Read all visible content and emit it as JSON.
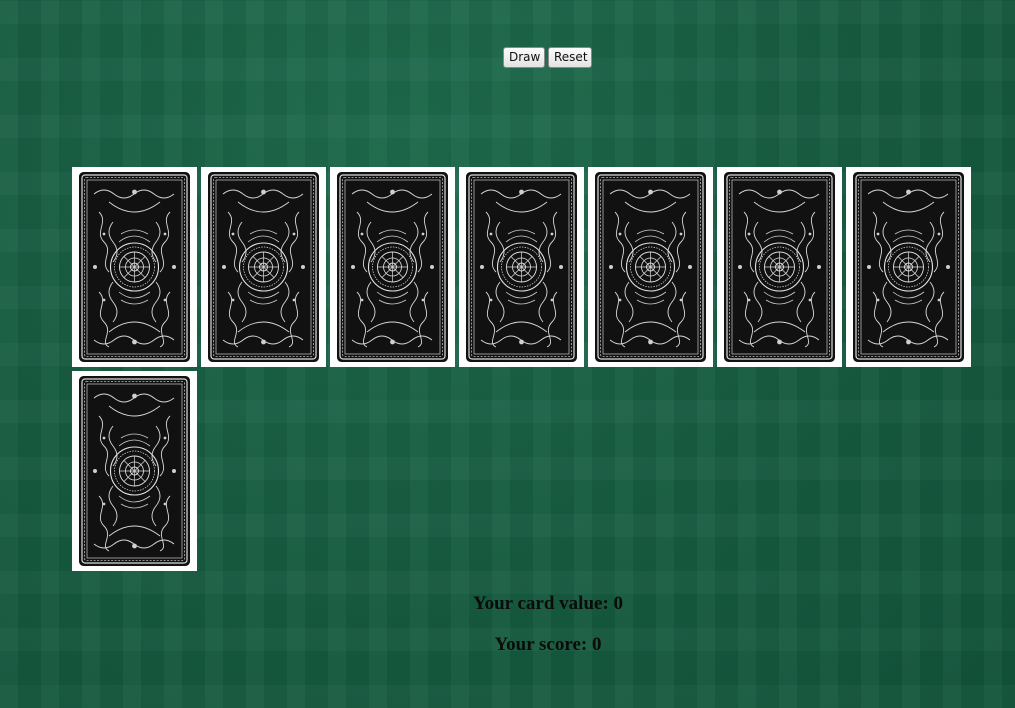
{
  "controls": {
    "draw_label": "Draw",
    "reset_label": "Reset"
  },
  "table": {
    "background_color": "#195f44",
    "cards": [
      {
        "face": "back"
      },
      {
        "face": "back"
      },
      {
        "face": "back"
      },
      {
        "face": "back"
      },
      {
        "face": "back"
      },
      {
        "face": "back"
      },
      {
        "face": "back"
      },
      {
        "face": "back"
      }
    ]
  },
  "status": {
    "card_value_text": "Your card value: 0",
    "score_text": "Your score: 0"
  }
}
